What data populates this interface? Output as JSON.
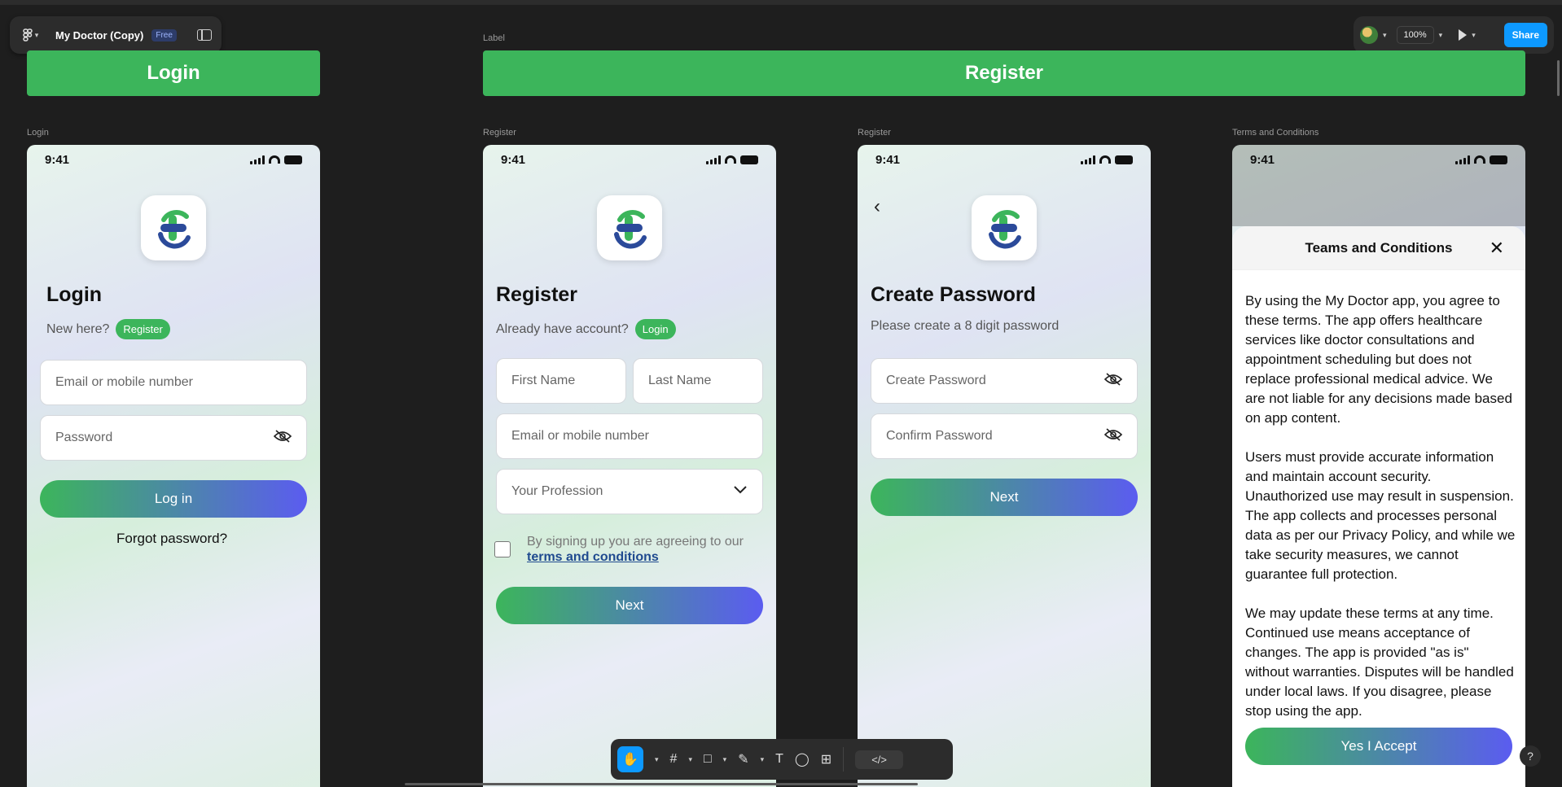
{
  "app": {
    "file_name": "My Doctor (Copy)",
    "plan_badge": "Free",
    "zoom": "100%",
    "share_label": "Share"
  },
  "banners": {
    "label": "Label",
    "login": "Login",
    "register": "Register"
  },
  "frames": {
    "login_label": "Login",
    "register_label": "Register",
    "password_label": "Register",
    "terms_label": "Terms and Conditions"
  },
  "status": {
    "time": "9:41"
  },
  "login": {
    "title": "Login",
    "sub": "New here?",
    "pill": "Register",
    "email_placeholder": "Email or mobile number",
    "password_placeholder": "Password",
    "button": "Log in",
    "forgot": "Forgot password?"
  },
  "register": {
    "title": "Register",
    "sub": "Already have account?",
    "pill": "Login",
    "first_name": "First Name",
    "last_name": "Last Name",
    "email": "Email or mobile number",
    "profession": "Your Profession",
    "agree_text": "By signing up you are agreeing to our",
    "agree_link": "terms and conditions",
    "button": "Next"
  },
  "create_password": {
    "title": "Create Password",
    "sub": "Please create a 8 digit password",
    "create": "Create Password",
    "confirm": "Confirm Password",
    "button": "Next"
  },
  "terms": {
    "title": "Teams and Conditions",
    "p1": "By using the My Doctor app, you agree to these terms. The app offers healthcare services like doctor consultations and appointment scheduling but does not replace professional medical advice. We are not liable for any decisions made based on app content.",
    "p2": "Users must provide accurate information and maintain account security. Unauthorized use may result in suspension. The app collects and processes personal data as per our Privacy Policy, and while we take security measures, we cannot guarantee full protection.",
    "p3": "We may update these terms at any time. Continued use means acceptance of changes. The app is provided \"as is\" without warranties. Disputes will be handled under local laws. If you disagree, please stop using the app.",
    "button": "Yes I Accept"
  },
  "colors": {
    "brand_green": "#3cb55b",
    "brand_purple": "#5b5cf0",
    "figma_blue": "#0d99ff"
  }
}
